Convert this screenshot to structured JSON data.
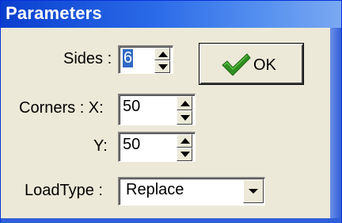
{
  "window": {
    "title": "Parameters"
  },
  "form": {
    "sides_label": "Sides :",
    "sides_value": "6",
    "corners_x_label": "Corners : X:",
    "corners_x_value": "50",
    "corners_y_label": "Y:",
    "corners_y_value": "50",
    "loadtype_label": "LoadType :",
    "loadtype_value": "Replace"
  },
  "buttons": {
    "ok_label": "OK"
  },
  "icons": {
    "ok": "checkmark-icon",
    "spin_up": "arrow-up-icon",
    "spin_down": "arrow-down-icon",
    "dropdown": "chevron-down-icon"
  },
  "colors": {
    "titlebar": "#0a3fce",
    "dialog_bg": "#ece9d8",
    "check": "#2f8f1f",
    "selection": "#316ac5"
  }
}
